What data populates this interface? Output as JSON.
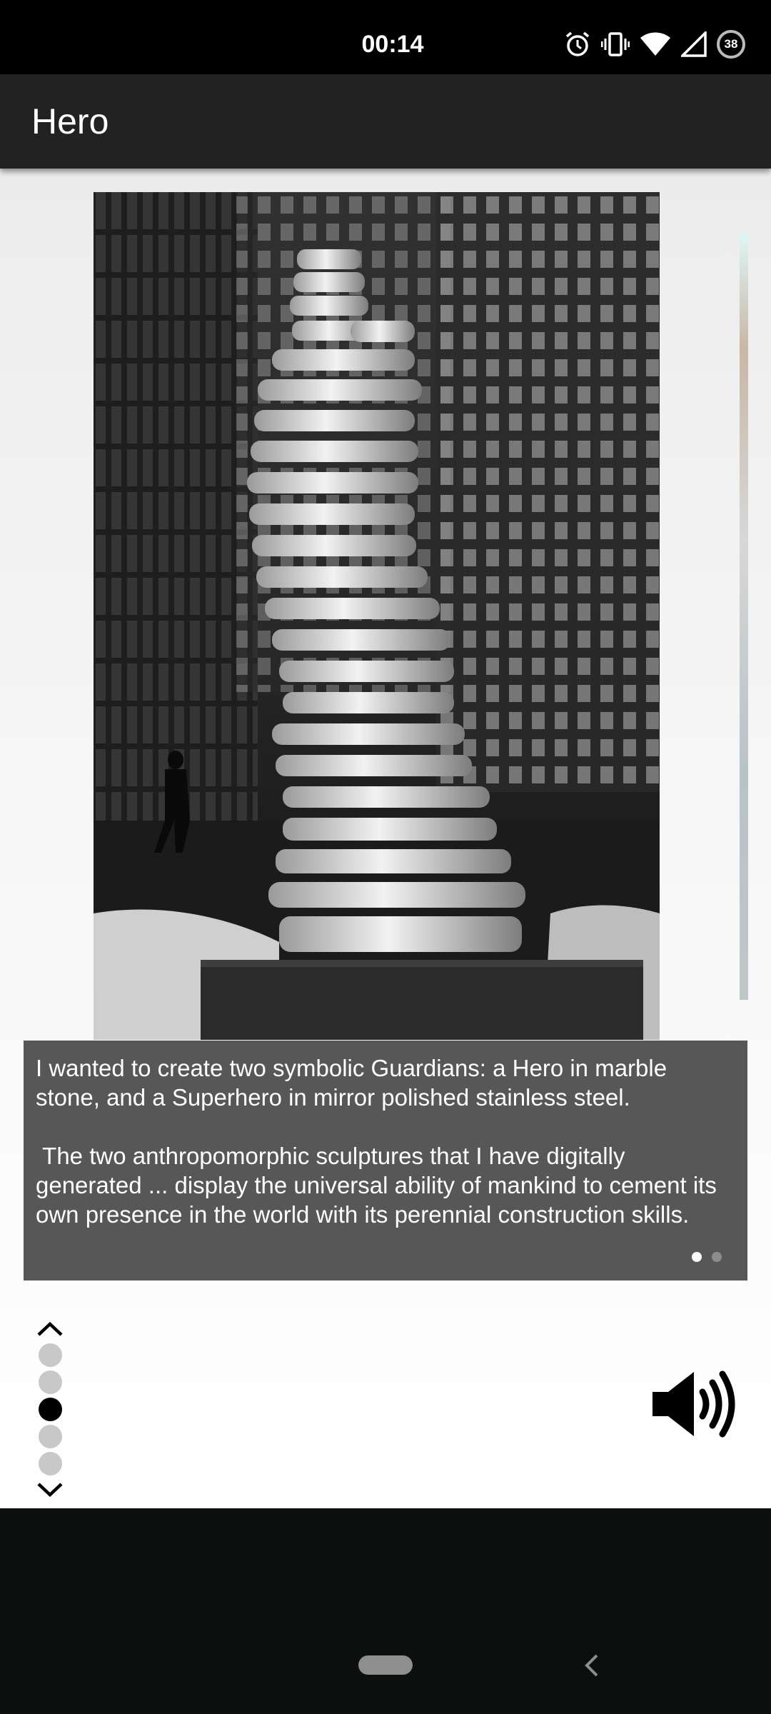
{
  "status_bar": {
    "time": "00:14",
    "battery_level": "38",
    "icons": [
      "alarm-icon",
      "vibrate-icon",
      "wifi-icon",
      "signal-icon",
      "battery-icon"
    ]
  },
  "app_bar": {
    "title": "Hero"
  },
  "gallery": {
    "current_image": "marble-hero-sculpture-photo",
    "caption": "I wanted to create two symbolic Guardians: a Hero in marble stone, and a Superhero in mirror polished stainless steel.\n\n The two anthropomorphic sculptures that I have digitally generated ... display the universal ability of mankind to cement its own presence in the world with its perennial construction skills.",
    "caption_pages": {
      "count": 2,
      "active_index": 0
    }
  },
  "page_navigator": {
    "up_icon": "chevron-up-icon",
    "down_icon": "chevron-down-icon",
    "dot_count": 5,
    "active_index": 2
  },
  "audio": {
    "icon": "speaker-volume-icon"
  },
  "system_nav": {
    "home": "home-pill",
    "back": "back-chevron-icon"
  },
  "colors": {
    "status_bar": "#000000",
    "app_bar": "#222222",
    "caption_bg": "#575757",
    "nav_dot": "#c8c8c8",
    "nav_dot_active": "#000000",
    "system_nav_bg": "#0b0f0d"
  }
}
